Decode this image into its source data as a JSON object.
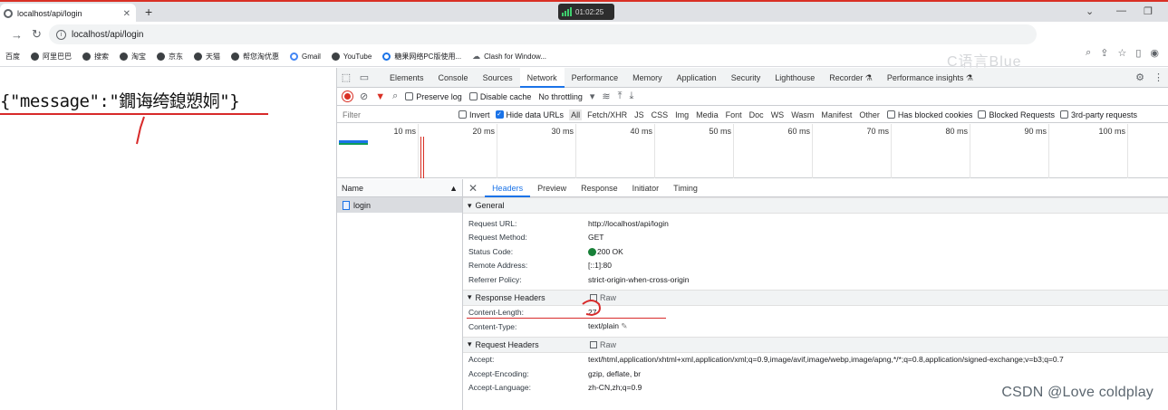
{
  "browser": {
    "tab_title": "localhost/api/login",
    "new_tab_symbol": "+",
    "close_symbol": "✕",
    "timer": "01:02:25",
    "url": "localhost/api/login",
    "watermark": "C语言Blue"
  },
  "bookmarks": [
    "百度",
    "阿里巴巴",
    "搜索",
    "淘宝",
    "京东",
    "天猫",
    "帮您淘优惠",
    "Gmail",
    "YouTube",
    "糖果网络PC版使用...",
    "Clash for Window..."
  ],
  "page": {
    "response_body": "{\"message\":\"鐗诲绔鎴愬姛\"}"
  },
  "devtools": {
    "tabs": [
      "Elements",
      "Console",
      "Sources",
      "Network",
      "Performance",
      "Memory",
      "Application",
      "Security",
      "Lighthouse",
      "Recorder ⚗",
      "Performance insights ⚗"
    ],
    "active_tab": "Network",
    "toolbar": {
      "preserve_log": "Preserve log",
      "disable_cache": "Disable cache",
      "throttling": "No throttling"
    },
    "filter": {
      "placeholder": "Filter",
      "invert": "Invert",
      "hide_data_urls": "Hide data URLs",
      "types": [
        "All",
        "Fetch/XHR",
        "JS",
        "CSS",
        "Img",
        "Media",
        "Font",
        "Doc",
        "WS",
        "Wasm",
        "Manifest",
        "Other"
      ],
      "has_blocked_cookies": "Has blocked cookies",
      "blocked_requests": "Blocked Requests",
      "third_party": "3rd-party requests"
    },
    "timeline_ticks": [
      "10 ms",
      "20 ms",
      "30 ms",
      "40 ms",
      "50 ms",
      "60 ms",
      "70 ms",
      "80 ms",
      "90 ms",
      "100 ms"
    ],
    "request_list": {
      "header": "Name",
      "items": [
        "login"
      ]
    },
    "detail_tabs": [
      "Headers",
      "Preview",
      "Response",
      "Initiator",
      "Timing"
    ],
    "general": {
      "title": "General",
      "rows": [
        {
          "k": "Request URL:",
          "v": "http://localhost/api/login"
        },
        {
          "k": "Request Method:",
          "v": "GET"
        },
        {
          "k": "Status Code:",
          "v": "200 OK"
        },
        {
          "k": "Remote Address:",
          "v": "[::1]:80"
        },
        {
          "k": "Referrer Policy:",
          "v": "strict-origin-when-cross-origin"
        }
      ]
    },
    "response_headers": {
      "title": "Response Headers",
      "raw": "Raw",
      "rows": [
        {
          "k": "Content-Length:",
          "v": "27"
        },
        {
          "k": "Content-Type:",
          "v": "text/plain"
        }
      ]
    },
    "request_headers": {
      "title": "Request Headers",
      "raw": "Raw",
      "rows": [
        {
          "k": "Accept:",
          "v": "text/html,application/xhtml+xml,application/xml;q=0.9,image/avif,image/webp,image/apng,*/*;q=0.8,application/signed-exchange;v=b3;q=0.7"
        },
        {
          "k": "Accept-Encoding:",
          "v": "gzip, deflate, br"
        },
        {
          "k": "Accept-Language:",
          "v": "zh-CN,zh;q=0.9"
        }
      ]
    }
  },
  "footer_watermark": "CSDN @Love coldplay"
}
